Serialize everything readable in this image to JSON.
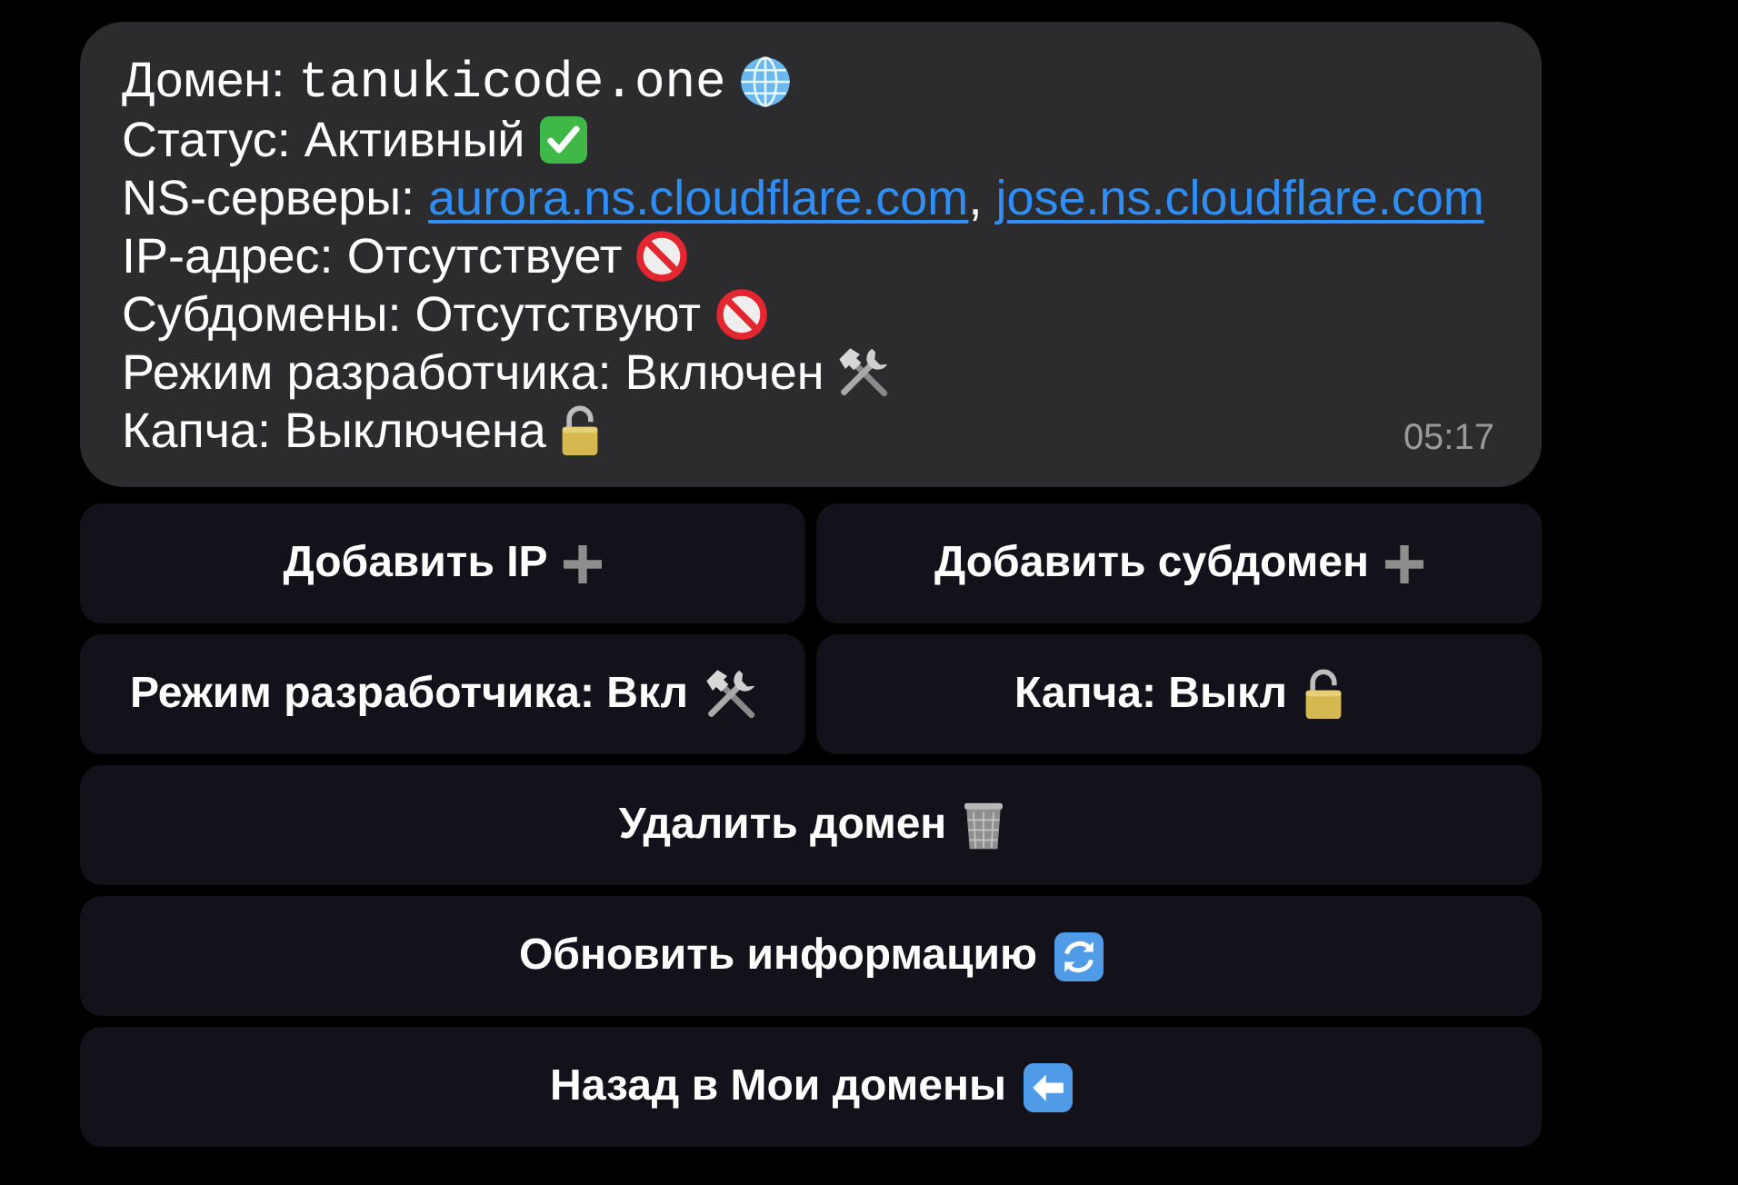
{
  "message": {
    "lines": [
      {
        "kind": "domain",
        "label": "Домен:",
        "value": "tanukicode.one"
      },
      {
        "kind": "status",
        "label": "Статус:",
        "value": "Активный"
      },
      {
        "kind": "nameservers",
        "label": "NS-серверы:",
        "links": [
          "aurora.ns.cloudflare.com",
          "jose.ns.cloudflare.com"
        ],
        "separator": ","
      },
      {
        "kind": "ip",
        "label": "IP-адрес:",
        "value": "Отсутствует"
      },
      {
        "kind": "subdomains",
        "label": "Субдомены:",
        "value": "Отсутствуют"
      },
      {
        "kind": "dev_mode",
        "label": "Режим разработчика:",
        "value": "Включен"
      },
      {
        "kind": "captcha",
        "label": "Капча:",
        "value": "Выключена"
      }
    ],
    "time": "05:17"
  },
  "keyboard": {
    "rows": [
      {
        "buttons": [
          {
            "kind": "add",
            "label": "Добавить IP"
          },
          {
            "kind": "add",
            "label": "Добавить субдомен"
          }
        ]
      },
      {
        "buttons": [
          {
            "kind": "dev_mode",
            "label": "Режим разработчика: Вкл"
          },
          {
            "kind": "captcha",
            "label": "Капча: Выкл"
          }
        ]
      },
      {
        "buttons": [
          {
            "kind": "delete",
            "label": "Удалить домен"
          }
        ]
      },
      {
        "buttons": [
          {
            "kind": "refresh",
            "label": "Обновить информацию"
          }
        ]
      },
      {
        "buttons": [
          {
            "kind": "back",
            "label": "Назад в Мои домены"
          }
        ]
      }
    ]
  }
}
